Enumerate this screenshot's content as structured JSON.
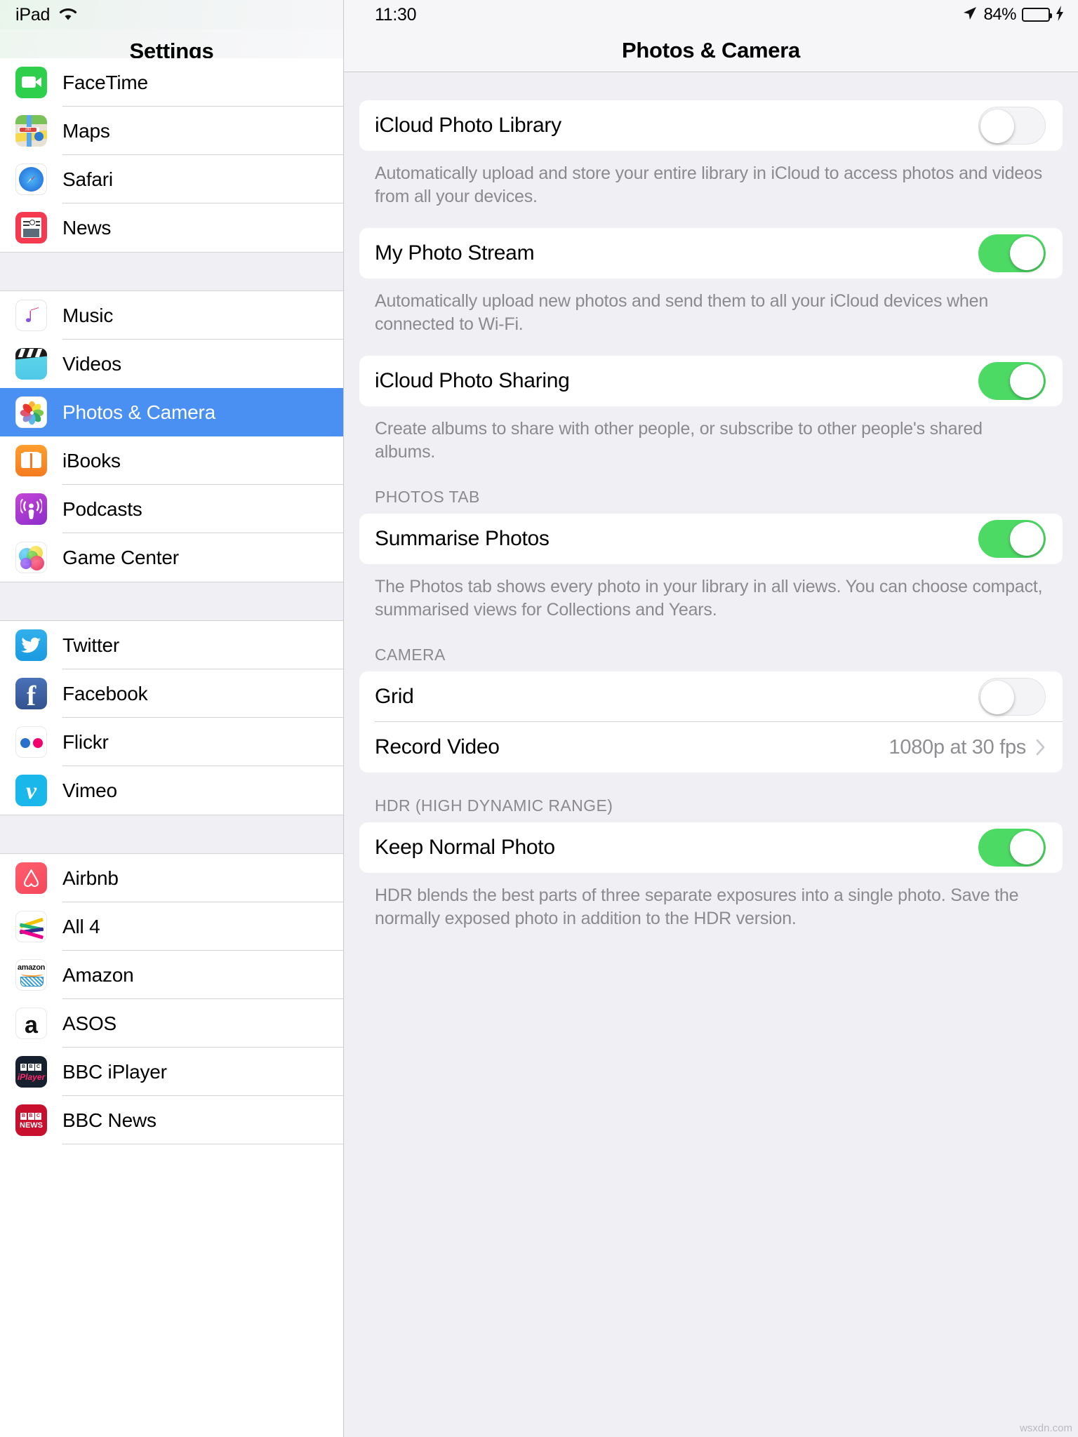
{
  "left_status_bar": {
    "device_name": "iPad",
    "wifi_icon": "wifi-icon"
  },
  "right_status_bar": {
    "time": "11:30",
    "location_icon": "location-arrow-icon",
    "battery_percent": "84%",
    "battery_icon": "battery-icon",
    "charging_icon": "lightning-bolt-icon"
  },
  "sidebar": {
    "title": "Settings",
    "selected_item": "Photos & Camera",
    "selected_color": "#4a90f2",
    "groups": [
      {
        "items": [
          {
            "label": "FaceTime",
            "icon": "facetime-icon"
          },
          {
            "label": "Maps",
            "icon": "maps-icon"
          },
          {
            "label": "Safari",
            "icon": "safari-icon"
          },
          {
            "label": "News",
            "icon": "news-icon"
          }
        ]
      },
      {
        "items": [
          {
            "label": "Music",
            "icon": "music-icon"
          },
          {
            "label": "Videos",
            "icon": "videos-icon"
          },
          {
            "label": "Photos & Camera",
            "icon": "photos-icon",
            "selected": true
          },
          {
            "label": "iBooks",
            "icon": "ibooks-icon"
          },
          {
            "label": "Podcasts",
            "icon": "podcasts-icon"
          },
          {
            "label": "Game Center",
            "icon": "game-center-icon"
          }
        ]
      },
      {
        "items": [
          {
            "label": "Twitter",
            "icon": "twitter-icon"
          },
          {
            "label": "Facebook",
            "icon": "facebook-icon"
          },
          {
            "label": "Flickr",
            "icon": "flickr-icon"
          },
          {
            "label": "Vimeo",
            "icon": "vimeo-icon"
          }
        ]
      },
      {
        "items": [
          {
            "label": "Airbnb",
            "icon": "airbnb-icon"
          },
          {
            "label": "All 4",
            "icon": "all4-icon"
          },
          {
            "label": "Amazon",
            "icon": "amazon-icon"
          },
          {
            "label": "ASOS",
            "icon": "asos-icon"
          },
          {
            "label": "BBC iPlayer",
            "icon": "bbc-iplayer-icon"
          },
          {
            "label": "BBC News",
            "icon": "bbc-news-icon"
          }
        ]
      }
    ]
  },
  "detail": {
    "title": "Photos & Camera",
    "sections": [
      {
        "rows": [
          {
            "label": "iCloud Photo Library",
            "control": "toggle",
            "value": "off"
          }
        ],
        "footnote": "Automatically upload and store your entire library in iCloud to access photos and videos from all your devices."
      },
      {
        "rows": [
          {
            "label": "My Photo Stream",
            "control": "toggle",
            "value": "on"
          }
        ],
        "footnote": "Automatically upload new photos and send them to all your iCloud devices when connected to Wi-Fi."
      },
      {
        "rows": [
          {
            "label": "iCloud Photo Sharing",
            "control": "toggle",
            "value": "on"
          }
        ],
        "footnote": "Create albums to share with other people, or subscribe to other people's shared albums."
      },
      {
        "header": "PHOTOS TAB",
        "rows": [
          {
            "label": "Summarise Photos",
            "control": "toggle",
            "value": "on"
          }
        ],
        "footnote": "The Photos tab shows every photo in your library in all views. You can choose compact, summarised views for Collections and Years."
      },
      {
        "header": "CAMERA",
        "rows": [
          {
            "label": "Grid",
            "control": "toggle",
            "value": "off"
          },
          {
            "label": "Record Video",
            "control": "disclosure",
            "value": "1080p at 30 fps",
            "chevron": "chevron-right-icon"
          }
        ],
        "footnote": ""
      },
      {
        "header": "HDR (HIGH DYNAMIC RANGE)",
        "rows": [
          {
            "label": "Keep Normal Photo",
            "control": "toggle",
            "value": "on"
          }
        ],
        "footnote": "HDR blends the best parts of three separate exposures into a single photo. Save the normally exposed photo in addition to the HDR version."
      }
    ]
  },
  "watermark": "wsxdn.com",
  "colors": {
    "selection_blue": "#4a90f2",
    "toggle_on_green": "#4cd964",
    "panel_background": "#efeff4",
    "card_background": "#ffffff",
    "secondary_text": "#8a8a8f"
  }
}
